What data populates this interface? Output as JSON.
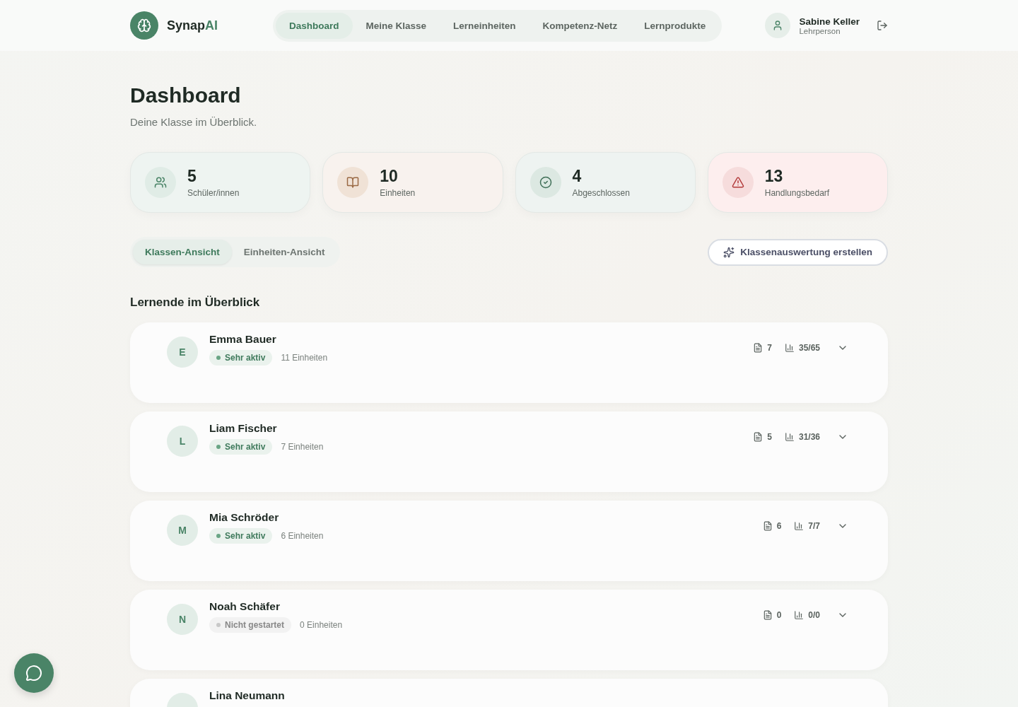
{
  "brand": {
    "name": "Synap",
    "accent": "AI"
  },
  "nav": [
    {
      "label": "Dashboard",
      "selected": true
    },
    {
      "label": "Meine Klasse",
      "selected": false
    },
    {
      "label": "Lerneinheiten",
      "selected": false
    },
    {
      "label": "Kompetenz-Netz",
      "selected": false
    },
    {
      "label": "Lernprodukte",
      "selected": false
    }
  ],
  "user": {
    "name": "Sabine Keller",
    "role": "Lehrperson"
  },
  "page": {
    "title": "Dashboard",
    "subtitle": "Deine Klasse im Überblick."
  },
  "stats": [
    {
      "kind": "people",
      "value": "5",
      "label": "Schüler/innen"
    },
    {
      "kind": "book",
      "value": "10",
      "label": "Einheiten"
    },
    {
      "kind": "done",
      "value": "4",
      "label": "Abgeschlossen"
    },
    {
      "kind": "alert",
      "value": "13",
      "label": "Handlungsbedarf"
    }
  ],
  "views": [
    {
      "label": "Klassen-Ansicht",
      "selected": true
    },
    {
      "label": "Einheiten-Ansicht",
      "selected": false
    }
  ],
  "report_button": "Klassenauswertung erstellen",
  "section_title": "Lernende im Überblick",
  "students": [
    {
      "initial": "E",
      "name": "Emma Bauer",
      "status": {
        "kind": "active",
        "label": "Sehr aktiv"
      },
      "units": "11 Einheiten",
      "documents": "7",
      "score": "35/65"
    },
    {
      "initial": "L",
      "name": "Liam Fischer",
      "status": {
        "kind": "active",
        "label": "Sehr aktiv"
      },
      "units": "7 Einheiten",
      "documents": "5",
      "score": "31/36"
    },
    {
      "initial": "M",
      "name": "Mia Schröder",
      "status": {
        "kind": "active",
        "label": "Sehr aktiv"
      },
      "units": "6 Einheiten",
      "documents": "6",
      "score": "7/7"
    },
    {
      "initial": "N",
      "name": "Noah Schäfer",
      "status": {
        "kind": "idle",
        "label": "Nicht gestartet"
      },
      "units": "0 Einheiten",
      "documents": "0",
      "score": "0/0"
    },
    {
      "name": "Lina Neumann"
    }
  ]
}
